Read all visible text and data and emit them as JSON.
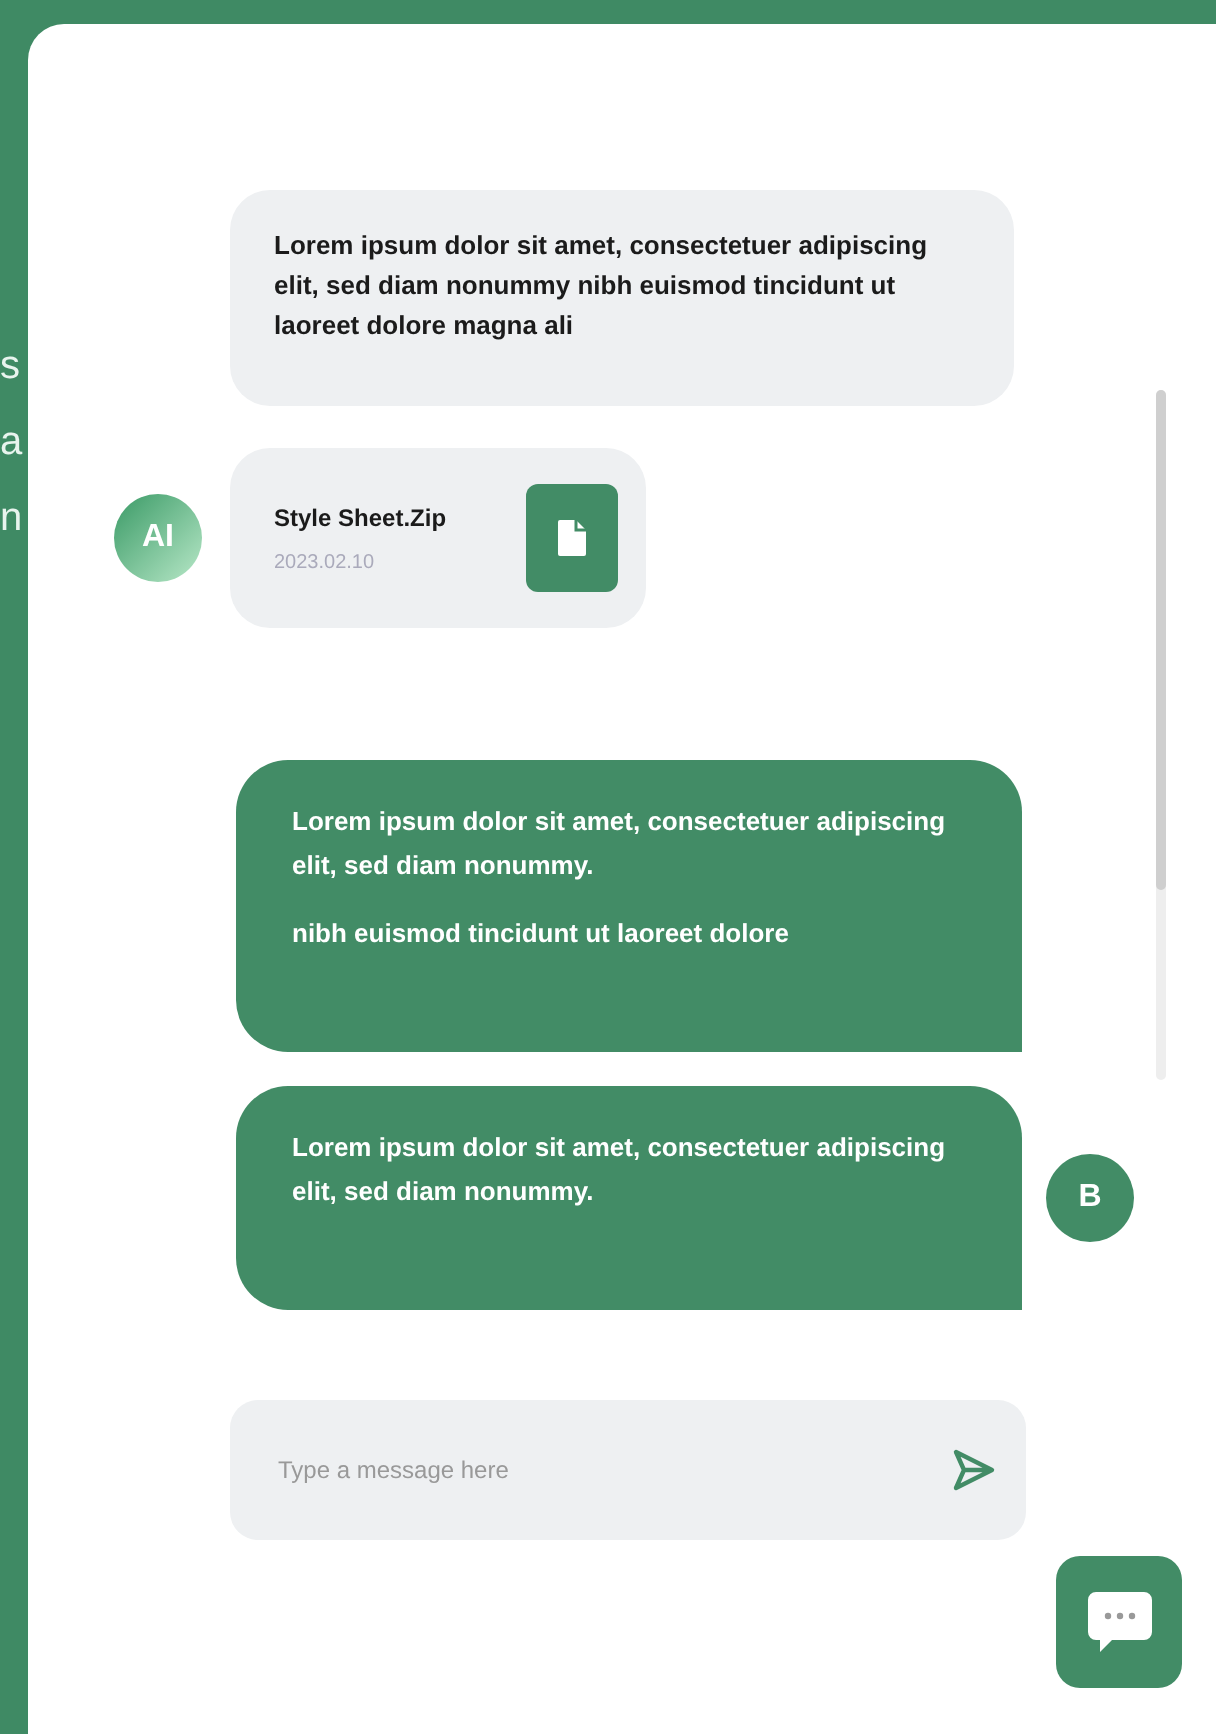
{
  "background_text": [
    "s",
    "a",
    "n"
  ],
  "messages": [
    {
      "outgoing": false,
      "kind": "text",
      "paragraphs": [
        "Lorem ipsum dolor sit amet, consectetuer adipiscing elit, sed diam nonummy nibh euismod tincidunt ut laoreet dolore magna ali"
      ]
    },
    {
      "outgoing": false,
      "kind": "file",
      "name": "Style Sheet.Zip",
      "date": "2023.02.10",
      "avatar": "AI"
    },
    {
      "outgoing": true,
      "kind": "text",
      "paragraphs": [
        "Lorem ipsum dolor sit amet, consectetuer adipiscing elit, sed diam nonummy.",
        "nibh euismod tincidunt ut laoreet dolore"
      ]
    },
    {
      "outgoing": true,
      "kind": "text",
      "paragraphs": [
        "Lorem ipsum dolor sit amet, consectetuer adipiscing elit, sed diam nonummy."
      ],
      "avatar": "B"
    }
  ],
  "composer": {
    "placeholder": "Type a message here"
  }
}
